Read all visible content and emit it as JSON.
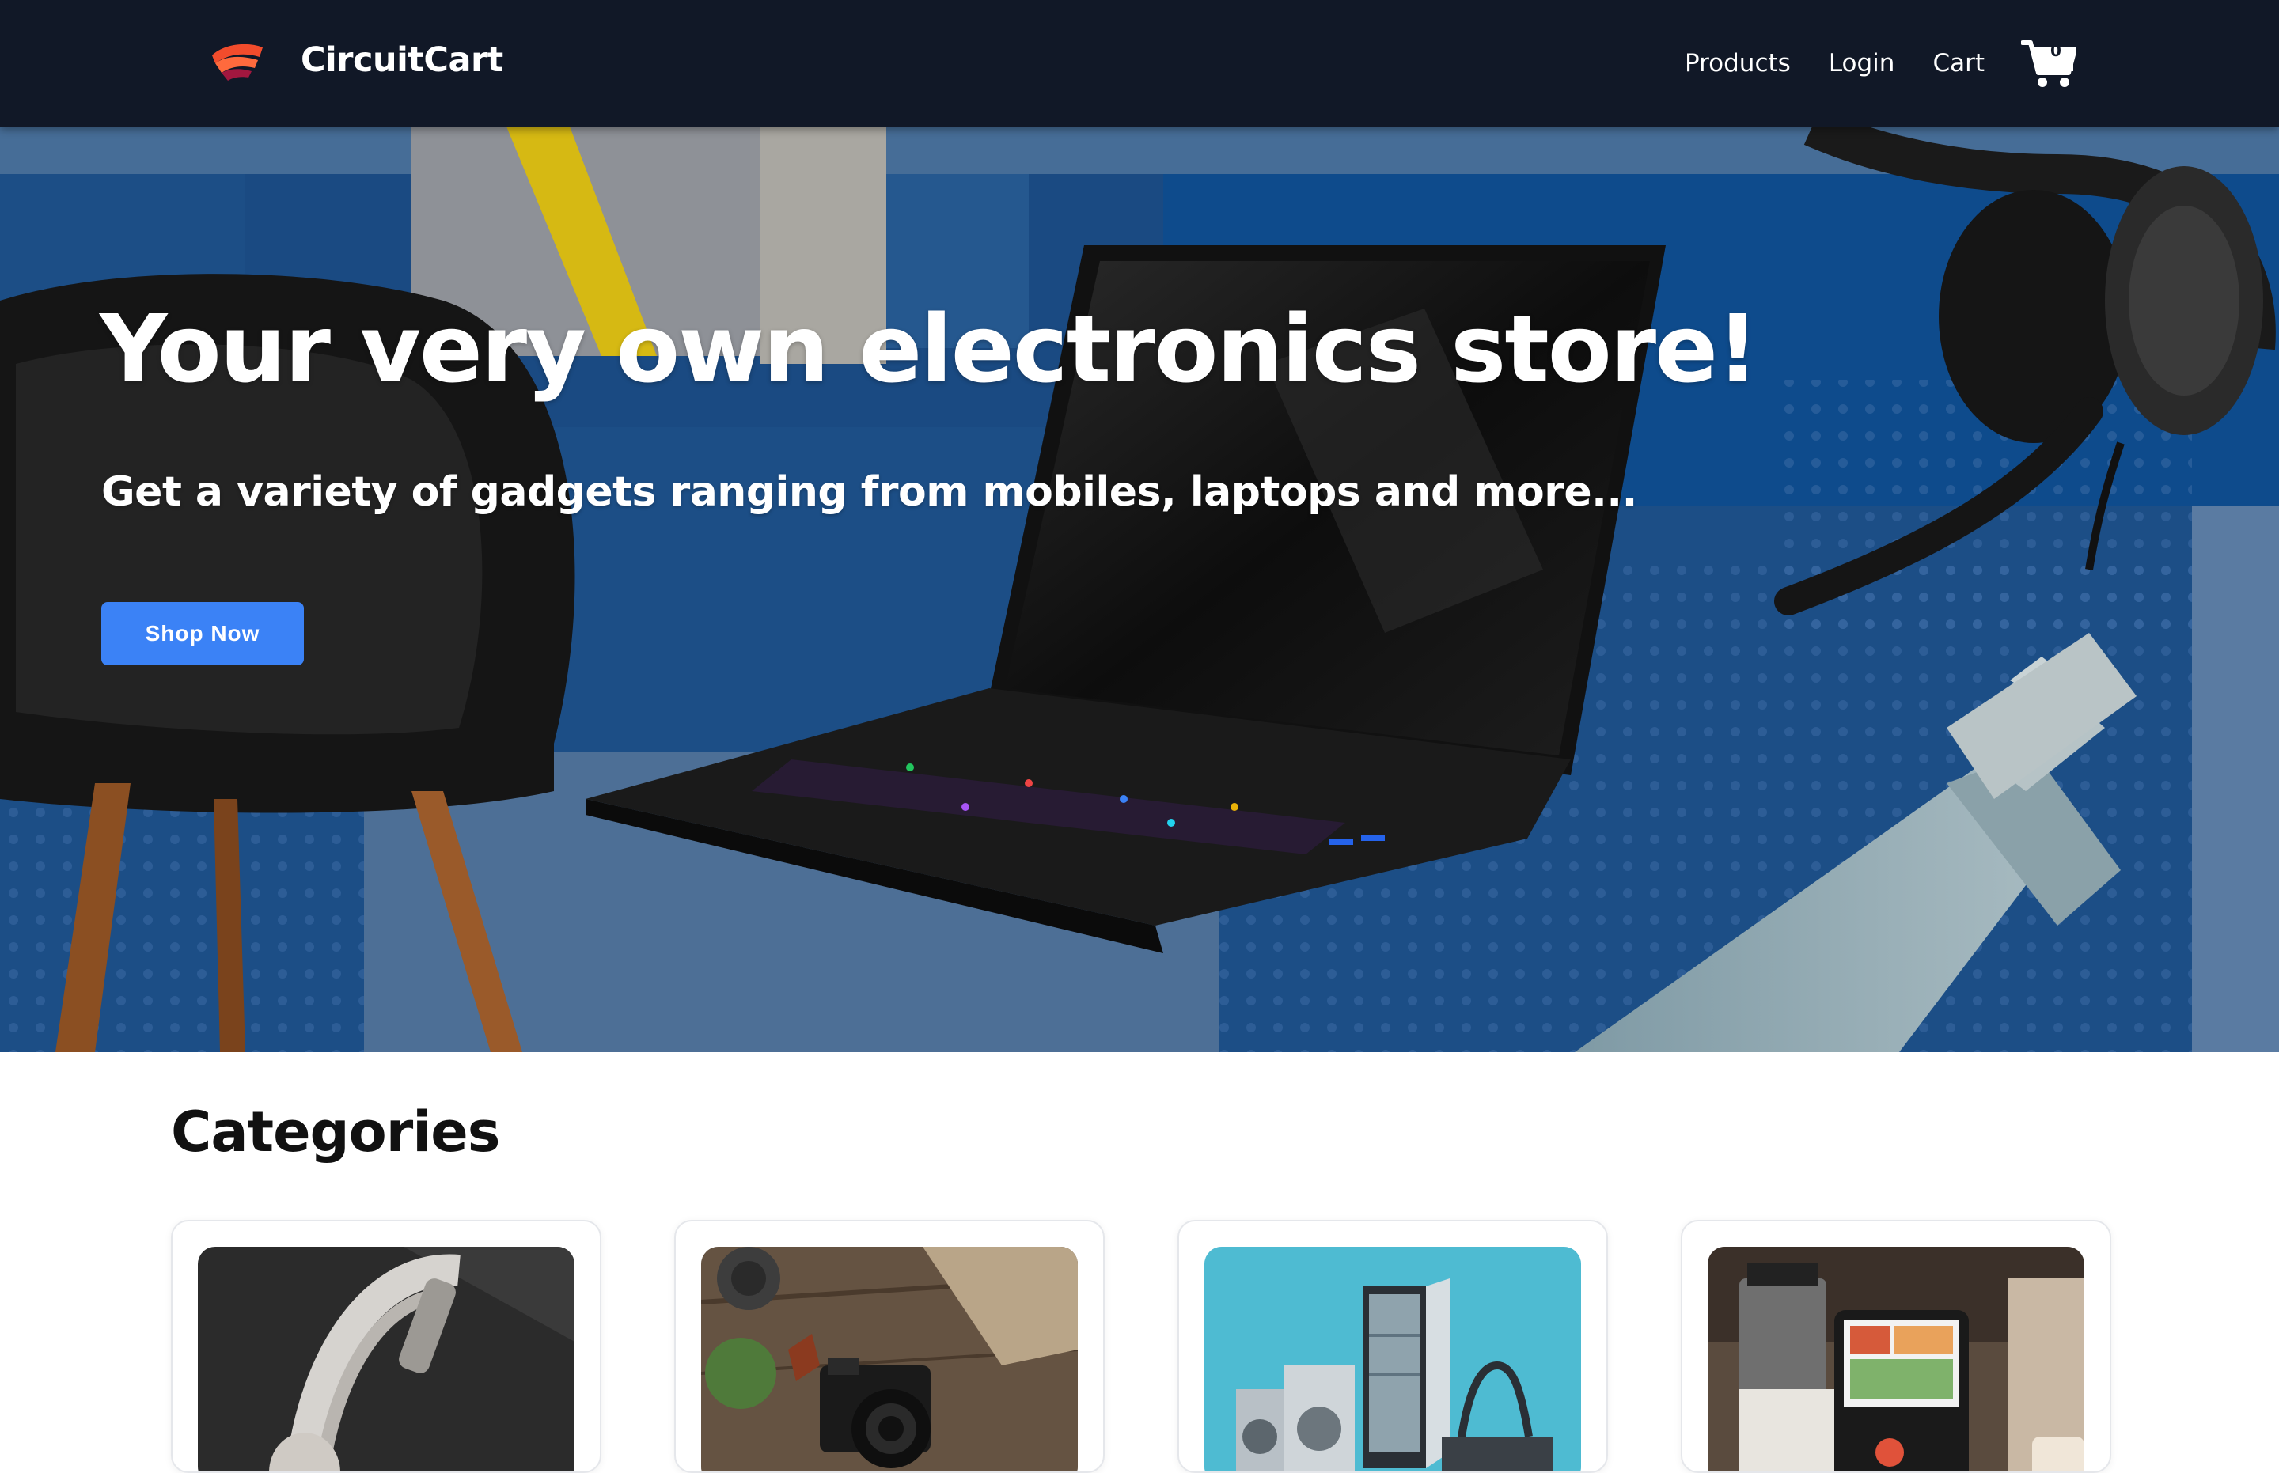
{
  "nav": {
    "brand": "CircuitCart",
    "links": {
      "products": "Products",
      "login": "Login",
      "cart": "Cart"
    },
    "cart_count": "0"
  },
  "hero": {
    "title": "Your very own electronics store!",
    "subtitle": "Get a variety of gadgets ranging from mobiles, laptops and more...",
    "cta_label": "Shop Now"
  },
  "categories": {
    "heading": "Categories",
    "items": [
      {
        "icon": "headphones-image"
      },
      {
        "icon": "camera-image"
      },
      {
        "icon": "appliances-image"
      },
      {
        "icon": "kitchen-gadgets-image"
      }
    ]
  },
  "colors": {
    "navbar": "#111827",
    "hero_blue": "#1d4f86",
    "cta_blue": "#3b82f6",
    "text_white": "#ffffff",
    "heading_dark": "#111111"
  }
}
